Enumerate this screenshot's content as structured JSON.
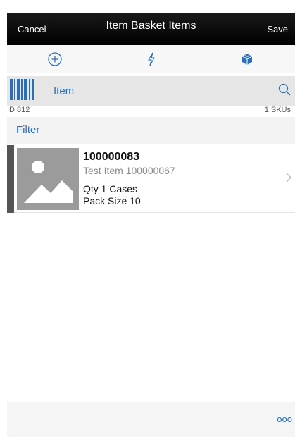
{
  "nav": {
    "cancel_label": "Cancel",
    "title": "Item Basket Items",
    "save_label": "Save"
  },
  "toolbar": {
    "icons": [
      "add-circle-icon",
      "lightning-icon",
      "cube-icon"
    ]
  },
  "scan": {
    "label": "Item",
    "id_text": "ID 812",
    "sku_count": "1 SKUs"
  },
  "filter": {
    "label": "Filter"
  },
  "items": [
    {
      "id": "100000083",
      "description": "Test Item 100000067",
      "qty": "Qty 1 Cases",
      "pack_size": "Pack Size 10"
    }
  ],
  "footer": {
    "more_label": "ooo"
  },
  "colors": {
    "accent": "#2a6fb5",
    "nav_bg": "#000000"
  }
}
